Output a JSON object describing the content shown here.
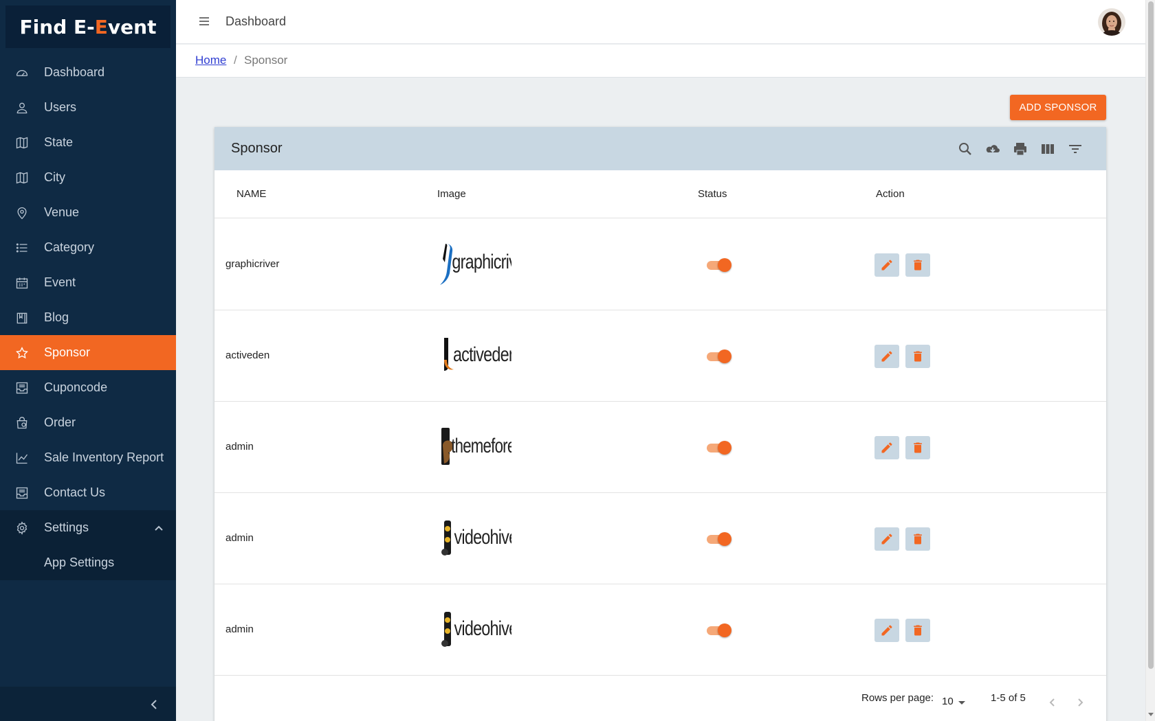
{
  "brand": {
    "part1": "Find E-",
    "accent": "E",
    "part2": "vent"
  },
  "sidebar": {
    "items": [
      {
        "label": "Dashboard",
        "icon": "dashboard-icon"
      },
      {
        "label": "Users",
        "icon": "user-icon"
      },
      {
        "label": "State",
        "icon": "map-icon"
      },
      {
        "label": "City",
        "icon": "map-icon"
      },
      {
        "label": "Venue",
        "icon": "location-pin-icon"
      },
      {
        "label": "Category",
        "icon": "list-icon"
      },
      {
        "label": "Event",
        "icon": "calendar-icon"
      },
      {
        "label": "Blog",
        "icon": "book-icon"
      },
      {
        "label": "Sponsor",
        "icon": "star-icon",
        "active": true
      },
      {
        "label": "Cuponcode",
        "icon": "inbox-icon"
      },
      {
        "label": "Order",
        "icon": "shopping-bag-icon"
      },
      {
        "label": "Sale Inventory Report",
        "icon": "chart-line-icon"
      },
      {
        "label": "Contact Us",
        "icon": "inbox-icon"
      },
      {
        "label": "Settings",
        "icon": "gear-icon",
        "expanded": true
      }
    ],
    "subitems": [
      {
        "label": "App Settings"
      }
    ]
  },
  "topbar": {
    "title": "Dashboard"
  },
  "breadcrumb": {
    "home": "Home",
    "separator": "/",
    "current": "Sponsor"
  },
  "add_button": {
    "label": "ADD SPONSOR"
  },
  "table": {
    "title": "Sponsor",
    "toolbar_icons": [
      "search-icon",
      "download-icon",
      "print-icon",
      "view-columns-icon",
      "filter-icon"
    ],
    "columns": [
      "NAME",
      "Image",
      "Status",
      "Action"
    ],
    "rows": [
      {
        "name": "graphicriver",
        "logo": "graphicriver",
        "status": true
      },
      {
        "name": "activeden",
        "logo": "activeden",
        "status": true
      },
      {
        "name": "admin",
        "logo": "themeforest",
        "status": true
      },
      {
        "name": "admin",
        "logo": "videohive",
        "status": true
      },
      {
        "name": "admin",
        "logo": "videohive",
        "status": true
      }
    ],
    "pagination": {
      "rows_per_page_label": "Rows per page:",
      "rows_per_page": "10",
      "range": "1-5 of 5"
    }
  },
  "colors": {
    "accent": "#f26722",
    "sidebar": "#0f2a44",
    "table_header": "#c8d7e2"
  }
}
